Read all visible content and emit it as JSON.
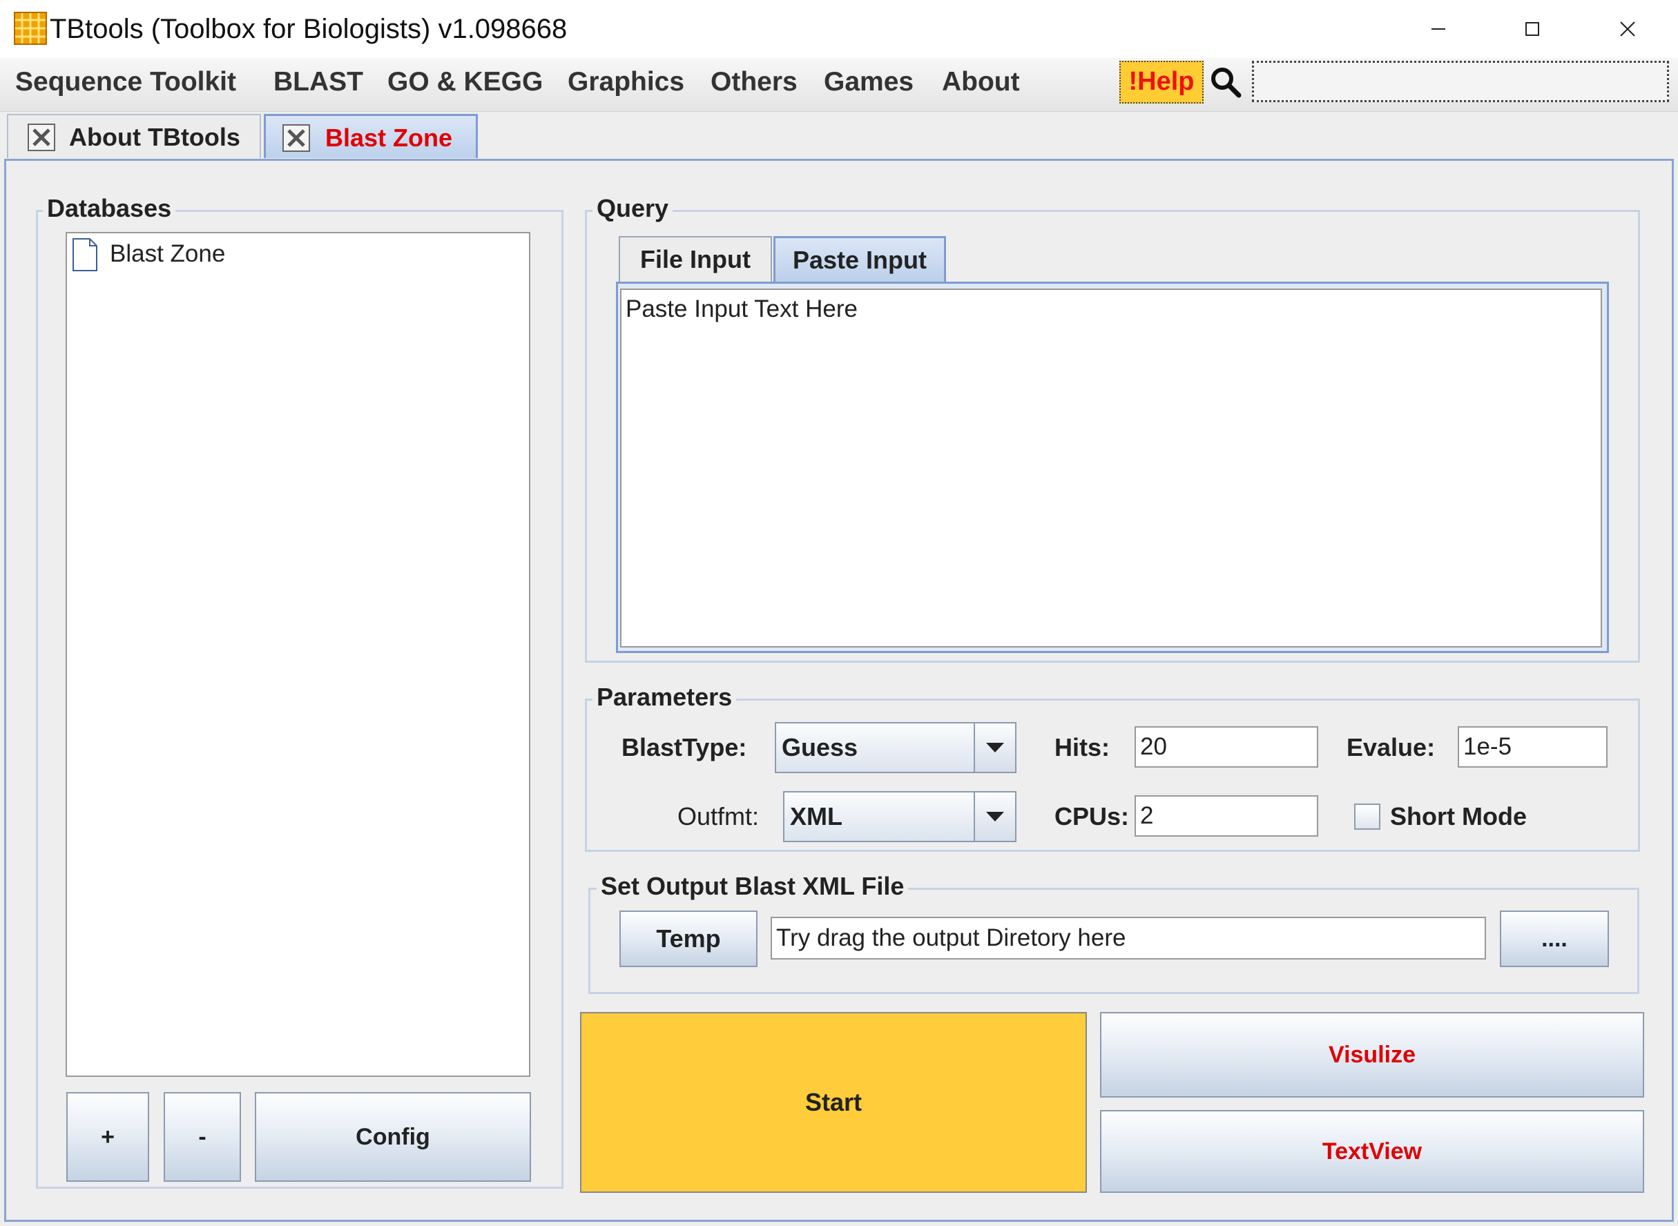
{
  "window": {
    "title": "TBtools (Toolbox for Biologists) v1.098668"
  },
  "menu": {
    "items": [
      "Sequence Toolkit",
      "BLAST",
      "GO & KEGG",
      "Graphics",
      "Others",
      "Games",
      "About"
    ],
    "help_label": "!Help",
    "search_placeholder": ""
  },
  "doc_tabs": [
    {
      "label": "About TBtools",
      "active": false
    },
    {
      "label": "Blast Zone",
      "active": true
    }
  ],
  "databases": {
    "title": "Databases",
    "items": [
      "Blast Zone"
    ],
    "buttons": {
      "add": "+",
      "remove": "-",
      "config": "Config"
    }
  },
  "query": {
    "title": "Query",
    "tabs": [
      "File Input",
      "Paste Input"
    ],
    "active_tab": "Paste Input",
    "paste_text": "Paste Input Text Here"
  },
  "parameters": {
    "title": "Parameters",
    "blast_type_label": "BlastType:",
    "blast_type_value": "Guess",
    "hits_label": "Hits:",
    "hits_value": "20",
    "evalue_label": "Evalue:",
    "evalue_value": "1e-5",
    "outfmt_label": "Outfmt:",
    "outfmt_value": "XML",
    "cpus_label": "CPUs:",
    "cpus_value": "2",
    "short_mode_label": "Short Mode",
    "short_mode_checked": false
  },
  "output": {
    "title": "Set Output Blast XML File",
    "temp_label": "Temp",
    "path_value": "Try drag the output Diretory here",
    "browse_label": "...."
  },
  "actions": {
    "start": "Start",
    "visualize": "Visulize",
    "textview": "TextView"
  },
  "colors": {
    "accent_red": "#e00000",
    "start_yellow": "#ffcc3b",
    "help_yellow": "#ffcc33",
    "border_blue": "#8aa4cf"
  }
}
